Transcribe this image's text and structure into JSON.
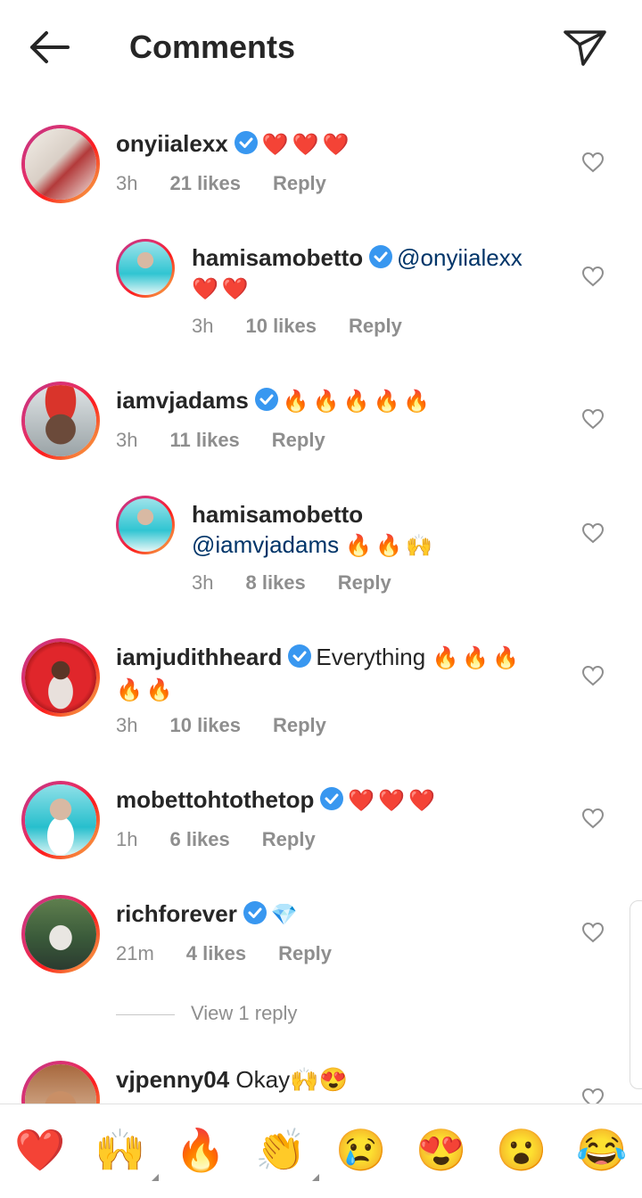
{
  "header": {
    "title": "Comments",
    "back_icon": "arrow-left-icon",
    "send_icon": "paper-plane-icon"
  },
  "comments": [
    {
      "username": "onyiialexx",
      "text": "❤️❤️❤️",
      "mention": "",
      "time": "3h",
      "likes": "21 likes",
      "reply": "Reply"
    },
    {
      "username": "hamisamobetto",
      "text": "❤️❤️",
      "mention": "@onyiialexx",
      "time": "3h",
      "likes": "10 likes",
      "reply": "Reply"
    },
    {
      "username": "iamvjadams",
      "text": "🔥🔥🔥🔥🔥",
      "mention": "",
      "time": "3h",
      "likes": "11 likes",
      "reply": "Reply"
    },
    {
      "username": "hamisamobetto",
      "text": "🔥🔥🙌",
      "mention": "@iamvjadams",
      "time": "3h",
      "likes": "8 likes",
      "reply": "Reply"
    },
    {
      "username": "iamjudithheard",
      "text": "Everything",
      "emoji": "🔥🔥🔥",
      "emoji2": "🔥🔥",
      "time": "3h",
      "likes": "10 likes",
      "reply": "Reply"
    },
    {
      "username": "mobettohtothetop",
      "text": "❤️❤️❤️",
      "time": "1h",
      "likes": "6 likes",
      "reply": "Reply"
    },
    {
      "username": "richforever",
      "text": "💎",
      "time": "21m",
      "likes": "4 likes",
      "reply": "Reply"
    },
    {
      "username": "vjpenny04",
      "text": "Okay🙌😍"
    }
  ],
  "view_replies": "View 1 reply",
  "reactions": [
    "❤️",
    "🙌",
    "🔥",
    "👏",
    "😢",
    "😍",
    "😮",
    "😂"
  ],
  "colors": {
    "mention": "#003569",
    "meta": "#8e8e8e",
    "verified": "#3897f0",
    "text": "#262626"
  }
}
